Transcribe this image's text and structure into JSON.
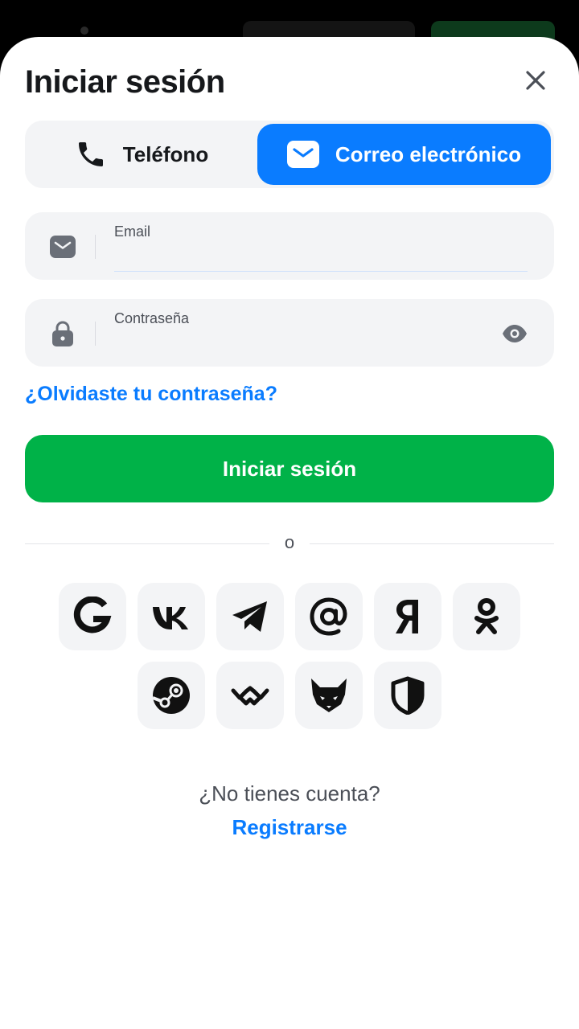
{
  "modal": {
    "title": "Iniciar sesión"
  },
  "tabs": [
    {
      "label": "Teléfono",
      "icon": "phone-icon",
      "active": false
    },
    {
      "label": "Correo electrónico",
      "icon": "envelope-icon",
      "active": true
    }
  ],
  "email_field": {
    "label": "Email",
    "value": "",
    "icon": "envelope-icon"
  },
  "password_field": {
    "label": "Contraseña",
    "value": "",
    "icon": "lock-icon",
    "toggle_icon": "eye-icon"
  },
  "forgot_link": "¿Olvidaste tu contraseña?",
  "login_button": "Iniciar sesión",
  "divider_text": "o",
  "social_icons": [
    "google-icon",
    "vk-icon",
    "telegram-icon",
    "mail-ru-icon",
    "yandex-icon",
    "odnoklassniki-icon",
    "steam-icon",
    "walletconnect-icon",
    "metamask-icon",
    "shield-icon"
  ],
  "no_account_text": "¿No tienes cuenta?",
  "register_link": "Registrarse",
  "colors": {
    "accent_blue": "#0a7cff",
    "primary_green": "#00b248",
    "field_bg": "#f3f4f6",
    "text_dark": "#16181b"
  }
}
